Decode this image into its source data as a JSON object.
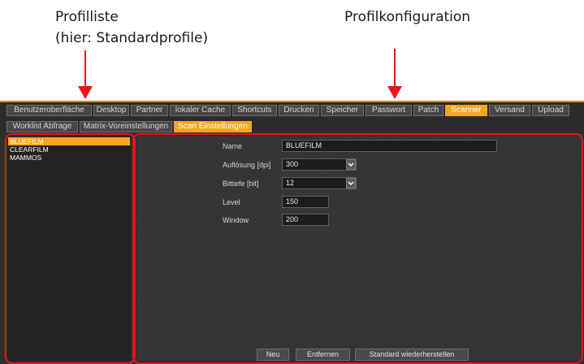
{
  "annotations": {
    "profile_list_line1": "Profilliste",
    "profile_list_line2": "(hier: Standardprofile)",
    "profile_config": "Profilkonfiguration"
  },
  "main_tabs": [
    {
      "label": "Benutzeroberfläche",
      "active": false
    },
    {
      "label": "Desktop",
      "active": false
    },
    {
      "label": "Partner",
      "active": false
    },
    {
      "label": "lokaler Cache",
      "active": false
    },
    {
      "label": "Shortcuts",
      "active": false
    },
    {
      "label": "Drucken",
      "active": false
    },
    {
      "label": "Speicher",
      "active": false
    },
    {
      "label": "Passwort",
      "active": false
    },
    {
      "label": "Patch",
      "active": false
    },
    {
      "label": "Scanner",
      "active": true
    },
    {
      "label": "Versand",
      "active": false
    },
    {
      "label": "Upload",
      "active": false
    }
  ],
  "sub_tabs": [
    {
      "label": "Worklist Abfrage",
      "active": false
    },
    {
      "label": "Matrix-Voreinstellungen",
      "active": false
    },
    {
      "label": "Scan Einstellungen",
      "active": true
    }
  ],
  "profiles": [
    {
      "name": "BLUEFILM",
      "selected": true
    },
    {
      "name": "CLEARFILM",
      "selected": false
    },
    {
      "name": "MAMMOS",
      "selected": false
    }
  ],
  "form": {
    "name_label": "Name",
    "name_value": "BLUEFILM",
    "resolution_label": "Auflösung [dpi]",
    "resolution_value": "300",
    "bitdepth_label": "Bittiefe [bit]",
    "bitdepth_value": "12",
    "level_label": "Level",
    "level_value": "150",
    "window_label": "Window",
    "window_value": "200"
  },
  "buttons": {
    "new": "Neu",
    "remove": "Entfernen",
    "restore_default": "Standard wiederherstellen"
  },
  "colors": {
    "accent": "#f5a623",
    "annotation": "#e8141a",
    "panel": "#343434"
  }
}
